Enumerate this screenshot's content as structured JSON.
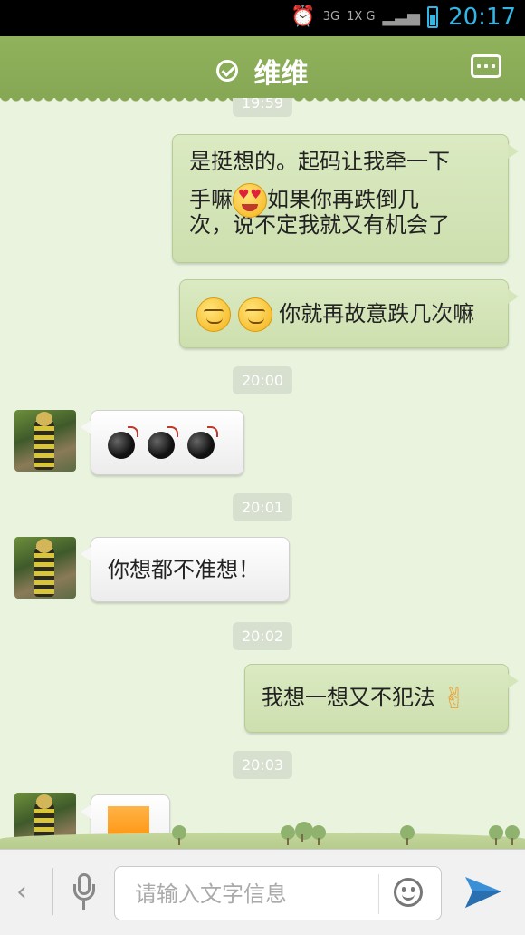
{
  "status_bar": {
    "time": "20:17",
    "network": "3G",
    "network2": "1X G",
    "alarm_icon": "alarm-clock-icon",
    "battery_icon": "battery-icon"
  },
  "header": {
    "contact_name": "维维",
    "verified_icon": "check-circle-icon",
    "more_icon": "more-dots-icon"
  },
  "chat": {
    "timestamps": [
      "19:59",
      "20:00",
      "20:01",
      "20:02",
      "20:03"
    ],
    "messages": [
      {
        "side": "right",
        "text_line1": "是挺想的。起码让我牵一下",
        "text_line2a": "手嘛",
        "text_line2b": "如果你再跌倒几",
        "text_line3": "次，说不定我就又有机会了"
      },
      {
        "side": "right",
        "text": "你就再故意跌几次嘛"
      },
      {
        "side": "left",
        "content": "bomb-emoji x3"
      },
      {
        "side": "left",
        "text": "你想都不准想！"
      },
      {
        "side": "right",
        "text": "我想一想又不犯法"
      },
      {
        "side": "left",
        "content": "image"
      }
    ]
  },
  "input_bar": {
    "back_label": "‹",
    "placeholder": "请输入文字信息",
    "mic_icon": "microphone-icon",
    "emoji_icon": "smiley-icon",
    "send_icon": "send-icon"
  }
}
